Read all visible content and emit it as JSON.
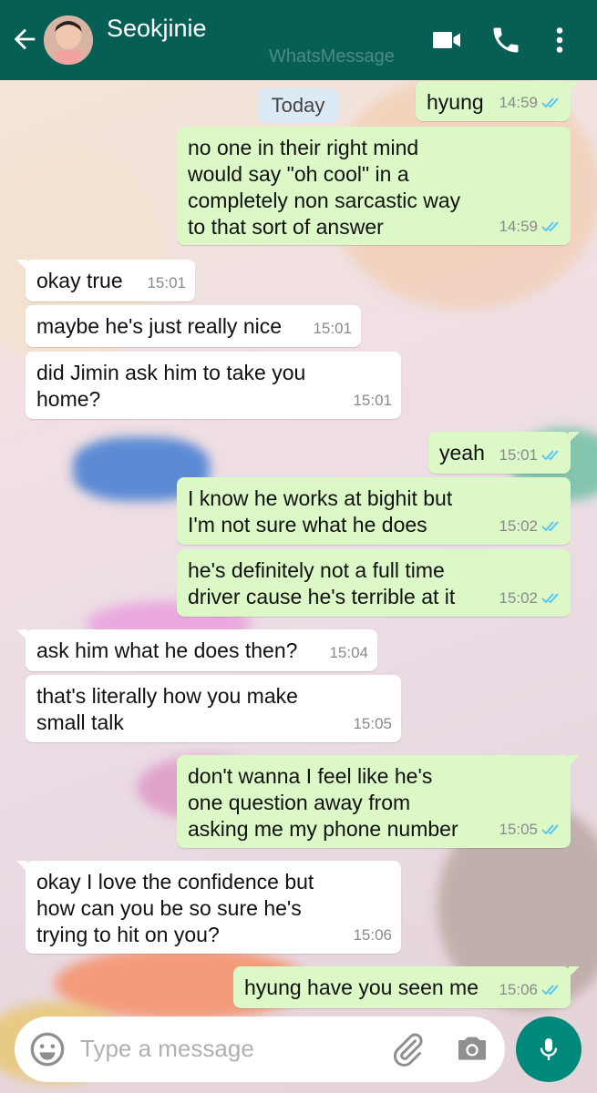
{
  "colors": {
    "header": "#075e54",
    "outgoing_bubble": "#dcf8c6",
    "incoming_bubble": "#ffffff",
    "read_tick": "#4fc3f7",
    "mic_button": "#00897b"
  },
  "header": {
    "contact_name": "Seokjinie",
    "watermark": "WhatsMessage",
    "icons": [
      "back-arrow-icon",
      "video-call-icon",
      "phone-icon",
      "more-options-icon"
    ]
  },
  "date_chip": "Today",
  "messages": [
    {
      "dir": "out",
      "text": "hyung",
      "time": "14:59"
    },
    {
      "dir": "out",
      "text": "no one in their right mind\nwould say \"oh cool\" in a\ncompletely non sarcastic way\nto that sort of answer",
      "time": "14:59"
    },
    {
      "dir": "in",
      "text": "okay true",
      "time": "15:01"
    },
    {
      "dir": "in",
      "text": "maybe he's just really nice",
      "time": "15:01"
    },
    {
      "dir": "in",
      "text": "did Jimin ask him to take you\nhome?",
      "time": "15:01"
    },
    {
      "dir": "out",
      "text": "yeah",
      "time": "15:01"
    },
    {
      "dir": "out",
      "text": "I know he works at bighit but\nI'm not sure what he does",
      "time": "15:02"
    },
    {
      "dir": "out",
      "text": "he's definitely not a full time\ndriver cause he's terrible at it",
      "time": "15:02"
    },
    {
      "dir": "in",
      "text": "ask him what he does then?",
      "time": "15:04"
    },
    {
      "dir": "in",
      "text": "that's literally how you make\nsmall talk",
      "time": "15:05"
    },
    {
      "dir": "out",
      "text": "don't wanna I feel like he's\none question away from\nasking me my phone number",
      "time": "15:05"
    },
    {
      "dir": "in",
      "text": "okay I love the confidence but\nhow can you be so sure he's\ntrying to hit on you?",
      "time": "15:06"
    },
    {
      "dir": "out",
      "text": "hyung have you seen me",
      "time": "15:06"
    }
  ],
  "input": {
    "placeholder": "Type a message",
    "icons": [
      "emoji-icon",
      "attach-icon",
      "camera-icon",
      "mic-icon"
    ]
  }
}
